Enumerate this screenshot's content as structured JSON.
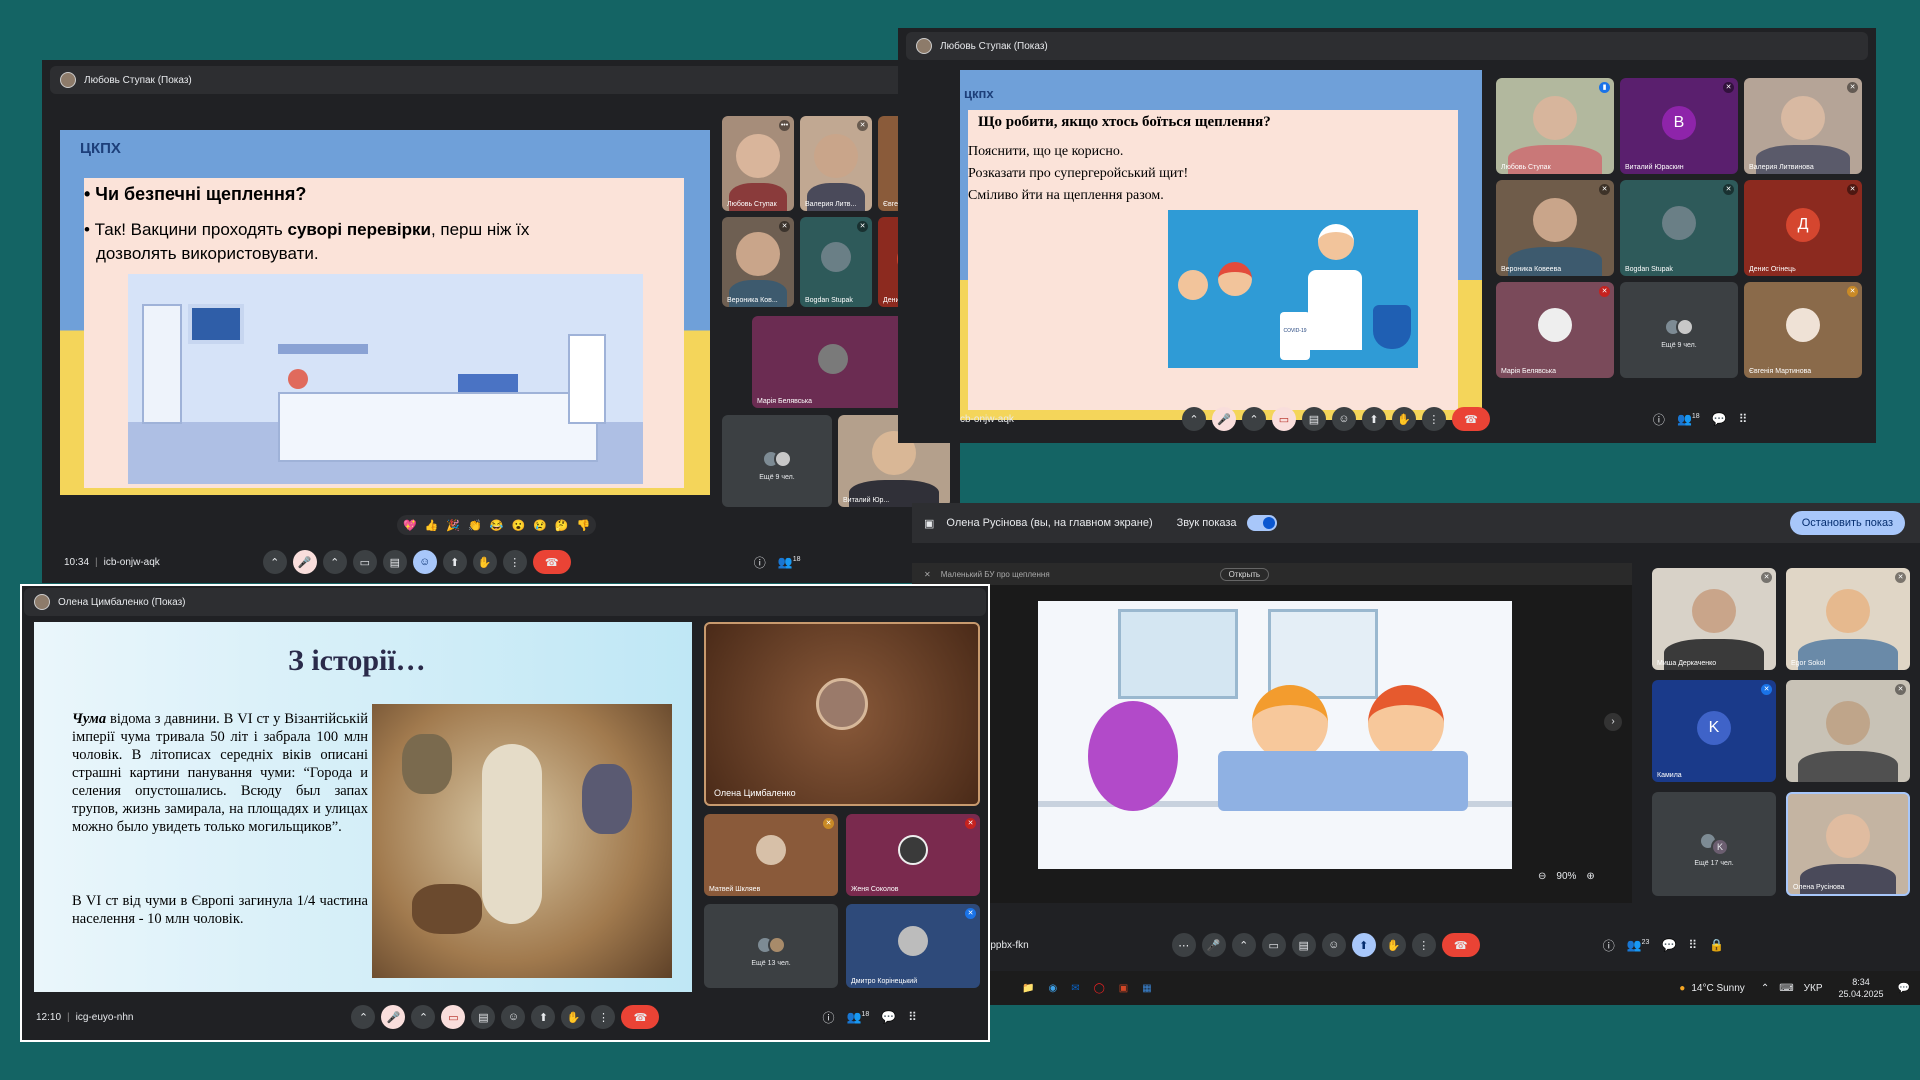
{
  "win1": {
    "presenter": "Любовь Ступак (Показ)",
    "logo": "ЦКПХ",
    "bullet1": "• Чи безпечні щеплення?",
    "bullet2a": "• Так! Вакцини проходять ",
    "bullet2b": "суворі перевірки",
    "bullet2c": ", перш ніж їх",
    "bullet2d": "дозволять використовувати.",
    "time": "10:34",
    "code": "icb-onjw-aqk",
    "participants_badge": "18",
    "tiles": [
      "Любовь Ступак",
      "Валерия Литв...",
      "Євгенія Март...",
      "Вероника Ков...",
      "Bogdan Stupak",
      "Денис Огінець",
      "Марія Белявська",
      "Ещё 9 чел.",
      "Виталий Юр..."
    ],
    "tile_letter": "Д",
    "reactions": [
      "💖",
      "👍",
      "🎉",
      "👏",
      "😂",
      "😮",
      "😢",
      "🤔",
      "👎"
    ]
  },
  "win2": {
    "presenter": "Любовь Ступак (Показ)",
    "logo": "цкпх",
    "title": "Що робити, якщо хтось боїться щеплення?",
    "line1": "Пояснити, що це корисно.",
    "line2": "Розказати про супергеройський щит!",
    "line3": "Сміливо йти на щеплення разом.",
    "vial": "COVID-19",
    "code": "cb-onjw-aqk",
    "participants_badge": "18",
    "tiles": [
      "Любовь Ступак",
      "Виталий Юраскин",
      "Валерия Литвинова",
      "Вероника Ковеева",
      "Bogdan Stupak",
      "Денис Огінець",
      "Марія Белявська",
      "Ещё 9 чел.",
      "Євгенія Мартинова"
    ],
    "letters": {
      "b": "В",
      "d": "Д"
    }
  },
  "win3": {
    "presenter": "Олена Цимбаленко (Показ)",
    "slide_title": "З історії…",
    "para1_word": "Чума",
    "para1": " відома з давнини. В VI ст у Візантійській імперії чума тривала 50 літ і забрала 100 млн чоловік. В літописах середніх віків описані страшні картини панування чуми: “Города и селения опустошались. Всюду был запах трупов, жизнь замирала, на площадях и улицах можно было увидеть только могильщиков”.",
    "para2": "В VI ст від чуми в Європі загинула 1/4 частина населення - 10 млн чоловік.",
    "main_tile": "Олена Цимбаленко",
    "tiles": [
      "Матвей Шкляев",
      "Женя Соколов",
      "Ещё 13 чел.",
      "Дмитро Корінецький"
    ],
    "time": "12:10",
    "code": "icg-euyo-nhn",
    "participants_badge": "18"
  },
  "win4": {
    "header": "Олена Русінова (вы, на главном экране)",
    "sound_label": "Звук показа",
    "stop_label": "Остановить показ",
    "tab_title": "Маленький БУ про щеплення",
    "open_label": "Открыть",
    "zoom": "90%",
    "tiles": [
      "Миша Деркаченко",
      "Egor Sokol",
      "Камила",
      "",
      "Ещё 17 чел.",
      "Олена Русінова"
    ],
    "letters": {
      "k": "K"
    },
    "code": "-ppbx-fkn",
    "participants_badge": "23"
  },
  "taskbar": {
    "weather": "14°C Sunny",
    "lang": "УКР",
    "time": "8:34",
    "date": "25.04.2025"
  }
}
